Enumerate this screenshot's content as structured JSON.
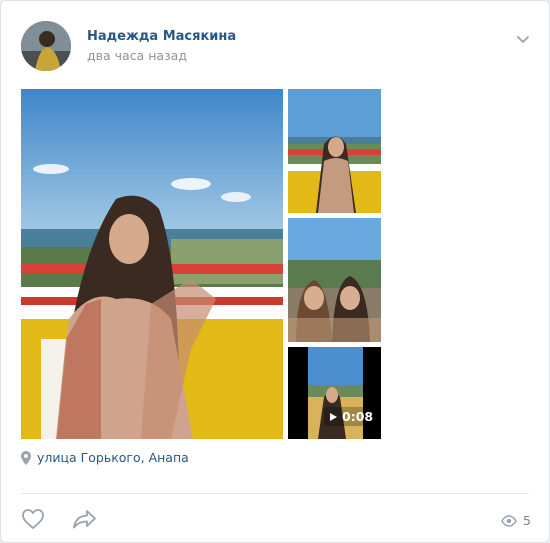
{
  "post": {
    "author_name": "Надежда Масякина",
    "time": "два часа назад"
  },
  "media": {
    "video_duration": "0:08"
  },
  "location": {
    "text": "улица Горького, Анапа"
  },
  "footer": {
    "views_count": "5"
  },
  "icons": {
    "menu": "chevron-down-icon",
    "location": "map-pin-icon",
    "like": "heart-icon",
    "share": "share-icon",
    "views": "eye-icon",
    "video": "play-icon"
  },
  "colors": {
    "link": "#2a5885",
    "muted": "#939393",
    "icon": "#99a2ad",
    "page_bg": "#edeef0"
  }
}
